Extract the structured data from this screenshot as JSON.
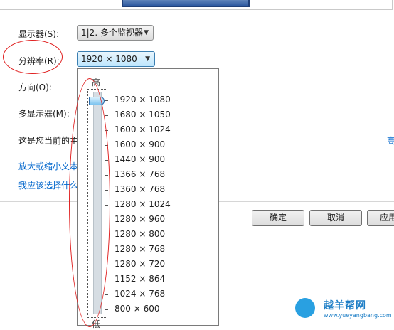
{
  "form": {
    "display_label": "显示器(S):",
    "display_value": "1|2. 多个监视器",
    "resolution_label": "分辨率(R):",
    "resolution_value": "1920 × 1080",
    "orientation_label": "方向(O):",
    "multi_display_label": "多显示器(M):",
    "current_text": "这是您当前的主",
    "advanced_link": "高"
  },
  "links": {
    "zoom_text": "放大或缩小文本",
    "which_settings": "我应该选择什么"
  },
  "buttons": {
    "ok": "确定",
    "cancel": "取消",
    "apply": "应用"
  },
  "dropdown": {
    "high_label": "高",
    "low_label": "低",
    "slider_selected_fraction": 0.0,
    "resolutions": [
      "1920 × 1080",
      "1680 × 1050",
      "1600 × 1024",
      "1600 × 900",
      "1440 × 900",
      "1366 × 768",
      "1360 × 768",
      "1280 × 1024",
      "1280 × 960",
      "1280 × 800",
      "1280 × 768",
      "1280 × 720",
      "1152 × 864",
      "1024 × 768",
      "800 × 600"
    ]
  },
  "watermark": {
    "name": "越羊帮网",
    "url": "www.yueyangbang.com"
  },
  "colors": {
    "link": "#0066cc",
    "annotation": "#e02020",
    "combo_active": "#bee6fd"
  }
}
